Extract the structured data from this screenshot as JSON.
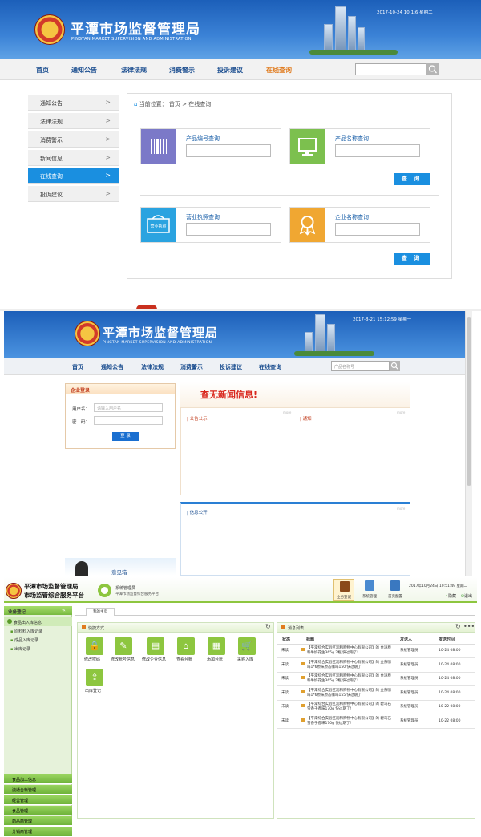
{
  "panel1": {
    "site_title": "平潭市场监督管理局",
    "site_subtitle": "PINGTAN MARKET SUPERVISION AND ADMINISTRATION",
    "timestamp": "2017-10-24 10:1:6 星期二",
    "nav": [
      "首页",
      "通知公告",
      "法律法规",
      "消费警示",
      "投诉建议",
      "在线查询"
    ],
    "sidebar": [
      "通知公告",
      "法律法规",
      "消费警示",
      "新闻信息",
      "在线查询",
      "投诉建议"
    ],
    "breadcrumb": "当前位置： 首页 >  在线查询",
    "cards": [
      "产品编号查询",
      "产品名称查询",
      "营业执照查询",
      "企业名称查询"
    ],
    "license_icon_text": "营业执照",
    "query_button": "查 询"
  },
  "panel2": {
    "site_title": "平潭市场监督管理局",
    "site_subtitle": "PINGTAN MARKET SUPERVISION AND ADMINISTRATION",
    "timestamp": "2017-8-21 15:12:59 星期一",
    "nav": [
      "首页",
      "通知公告",
      "法律法规",
      "消费警示",
      "投诉建议",
      "在线查询"
    ],
    "search_placeholder": "产品名称号",
    "login_title": "企业登录",
    "username_label": "用户名：",
    "username_placeholder": "请输入用户名",
    "password_label": "密　码：",
    "login_button": "登 录",
    "no_news": "查无新闻信息!",
    "notice_title": "公告公示",
    "notify_title": "通知",
    "info_title": "信息公开",
    "mailbox": "意见箱",
    "more": "more"
  },
  "panel3": {
    "title_line1": "平潭市场监督管理局",
    "title_line2": "市场监管综合服务平台",
    "sys_name": "系统管理员",
    "sys_sub": "平潭市场监督综合服务平台",
    "top_icons": [
      "业务登记",
      "系统管理",
      "首页配置"
    ],
    "timestamp": "2017年10月24日 10:51:49 星期二",
    "top_links": [
      "隐藏",
      "退出"
    ],
    "side_header": "业务登记",
    "side_group1": "食品出入库信息",
    "side_items": [
      "原料料入库记录",
      "成品入库记录",
      "出库记录"
    ],
    "side_groups": [
      "食品加工信息",
      "流通台帐管理",
      "经营管理",
      "食品管理",
      "药品商管理",
      "分销商管理"
    ],
    "tab": "我的主页",
    "quick_title": "快捷方式",
    "quick_items": [
      "修改密码",
      "修改账号信息",
      "修改企业信息",
      "查看台帐",
      "添加台账",
      "采购入库",
      "出库登记"
    ],
    "msg_title": "消息列表",
    "msg_headers": [
      "状态",
      "标题",
      "发送人",
      "发送时间"
    ],
    "messages": [
      {
        "status": "未读",
        "title": "【平潭综合实验区润和购物中心有限公司】的 台湾原料牛奶花生365g 2瓶 快过期了!",
        "sender": "系统管理员",
        "time": "10-24 08:00"
      },
      {
        "status": "未读",
        "title": "【平潭综合实验区润和购物中心有限公司】的 金燕咖啡1*6原味原态咖啡150 快过期了!",
        "sender": "系统管理员",
        "time": "10-24 08:00"
      },
      {
        "status": "未读",
        "title": "【平潭综合实验区润和购物中心有限公司】的 台湾原料牛奶花生365g 2瓶 快过期了!",
        "sender": "系统管理员",
        "time": "10-24 08:00"
      },
      {
        "status": "未读",
        "title": "【平潭综合实验区润和购物中心有限公司】的 金燕咖啡1*6原味原态咖啡155 快过期了!",
        "sender": "系统管理员",
        "time": "10-24 08:00"
      },
      {
        "status": "未读",
        "title": "【平潭综合实验区润和购物中心有限公司】的 碧马石雪香子香味170g 快过期了!",
        "sender": "系统管理员",
        "time": "10-22 08:00"
      },
      {
        "status": "未读",
        "title": "【平潭综合实验区润和购物中心有限公司】的 碧马石雪香子香味170g 快过期了!",
        "sender": "系统管理员",
        "time": "10-22 08:00"
      }
    ]
  },
  "colors": {
    "blue": "#1a8fe0",
    "navy": "#1a4d8f",
    "orange": "#e07b1e",
    "green": "#8dc63f",
    "red": "#d9251c"
  }
}
